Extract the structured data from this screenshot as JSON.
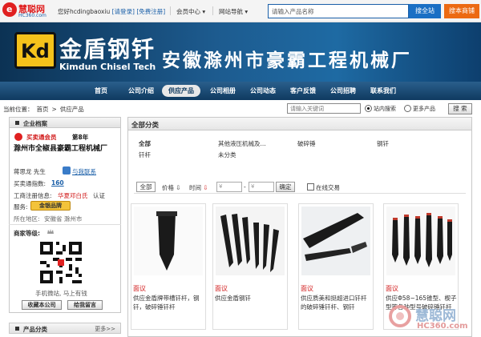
{
  "topbar": {
    "logo_name": "慧聪网",
    "logo_domain": "HC360.com",
    "greeting": "您好hcdingbaoxiu",
    "login_link": "[请登录]",
    "register_link": "[免费注册]",
    "member_center": "会员中心",
    "site_nav": "网站导航",
    "search_placeholder": "请输入产品名称",
    "search_button": "搜全站",
    "merchant_button": "搜本商铺"
  },
  "banner": {
    "logo_mark": "Kd",
    "brand_cn": "金盾钢钎",
    "brand_en": "Kimdun Chisel Tech",
    "company_name": "安徽滁州市豪霸工程机械厂"
  },
  "nav": {
    "items": [
      "首页",
      "公司介绍",
      "供应产品",
      "公司相册",
      "公司动态",
      "客户反馈",
      "公司招聘",
      "联系我们"
    ],
    "active": "供应产品"
  },
  "breadcrumb": {
    "label": "当前位置：",
    "home": "首页",
    "sep": ">",
    "current": "供应产品",
    "keyword_placeholder": "请输入关键词",
    "scope_site": "站内搜索",
    "scope_more": "更多产品",
    "search_button": "搜 索"
  },
  "sidebar": {
    "title": "企业档案",
    "member_badge": "买卖通会员",
    "member_years": "第8年",
    "company": "滁州市全椒县豪霸工程机械厂",
    "contact_name": "蒋思龙  先生",
    "contact_link": "与我联系",
    "index_label": "买卖通指数:",
    "index_value": "160",
    "auth_label": "工商注册信息:",
    "auth_value": "华夏邓白氏",
    "auth_suffix": "认证",
    "service_label": "服务:",
    "service_value": "金银品牌",
    "region_label": "所在地区:",
    "region_value": "安徽省  滁州市",
    "rating_label": "商家等级:",
    "mobile_caption": "手机微站, 马上有钱",
    "fav_button": "收藏本公司",
    "msg_button": "给我留言",
    "products_title": "产品分类",
    "more": "更多>>"
  },
  "main": {
    "title": "全部分类",
    "categories": {
      "all": "全部",
      "c1": "其他液压机械及...",
      "c2": "破碎锤",
      "c3": "钢钎",
      "c4": "钎杆",
      "c5": "未分类"
    },
    "filter": {
      "all": "全部",
      "price": "价格",
      "time": "时间",
      "min_placeholder": "¥",
      "max_placeholder": "¥",
      "confirm": "确定",
      "online": "在线交易"
    },
    "products": [
      {
        "price": "面议",
        "desc": "供应金盾牌带槽钎杆，钢钎，破碎锤钎杆"
      },
      {
        "price": "面议",
        "desc": "供应金盾钢钎"
      },
      {
        "price": "面议",
        "desc": "供应质美和挺超进口钎杆的破碎锤钎杆、钢钎"
      },
      {
        "price": "面议",
        "desc": "供应Φ58~165锥型、楔子型等各种型号破碎锤钎杆"
      }
    ]
  },
  "watermark": {
    "name": "慧聪网",
    "domain": "HC360.com"
  }
}
